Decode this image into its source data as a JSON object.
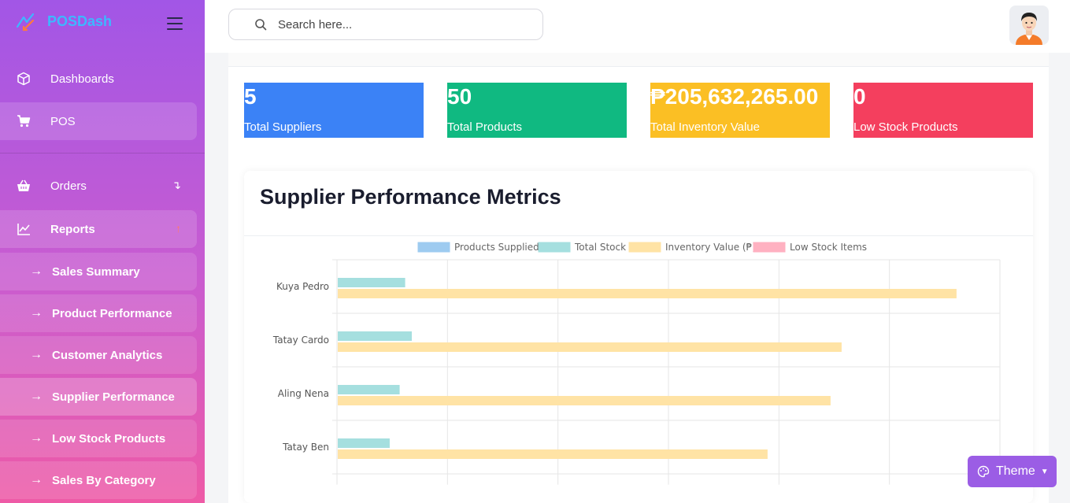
{
  "brand": {
    "name": "POSDash"
  },
  "search": {
    "placeholder": "Search here..."
  },
  "nav": {
    "dashboards": "Dashboards",
    "pos": "POS",
    "orders": "Orders",
    "orders_arrow": "↴",
    "reports": "Reports",
    "reports_arrow": "↑"
  },
  "reports_sub": [
    "Sales Summary",
    "Product Performance",
    "Customer Analytics",
    "Supplier Performance",
    "Low Stock Products",
    "Sales By Category"
  ],
  "stats": [
    {
      "value": "5",
      "label": "Total Suppliers",
      "color": "#3b82f6"
    },
    {
      "value": "50",
      "label": "Total Products",
      "color": "#10b981"
    },
    {
      "value": "₱205,632,265.00",
      "label": "Total Inventory Value",
      "color": "#fbbf24"
    },
    {
      "value": "0",
      "label": "Low Stock Products",
      "color": "#f43f5e"
    }
  ],
  "card": {
    "title": "Supplier Performance Metrics"
  },
  "theme": {
    "label": "Theme"
  },
  "chart_data": {
    "type": "bar",
    "orientation": "horizontal",
    "categories": [
      "Kuya Pedro",
      "Tatay Cardo",
      "Aling Nena",
      "Tatay Ben"
    ],
    "series": [
      {
        "name": "Products Supplied",
        "color": "#9ecbf0",
        "values": [
          10,
          10,
          10,
          10
        ]
      },
      {
        "name": "Total Stock",
        "color": "#a5dfdf",
        "values": [
          6100000,
          6700000,
          5600000,
          4700000
        ]
      },
      {
        "name": "Inventory Value (₱)",
        "color": "#ffe3a5",
        "values": [
          56000000,
          45600000,
          44600000,
          38900000
        ]
      },
      {
        "name": "Low Stock Items",
        "color": "#ffb1c1",
        "values": [
          0,
          0,
          0,
          0
        ]
      }
    ],
    "xlim": [
      0,
      60000000
    ],
    "grid": true,
    "legend": "top",
    "x_ticks_visible": false
  }
}
